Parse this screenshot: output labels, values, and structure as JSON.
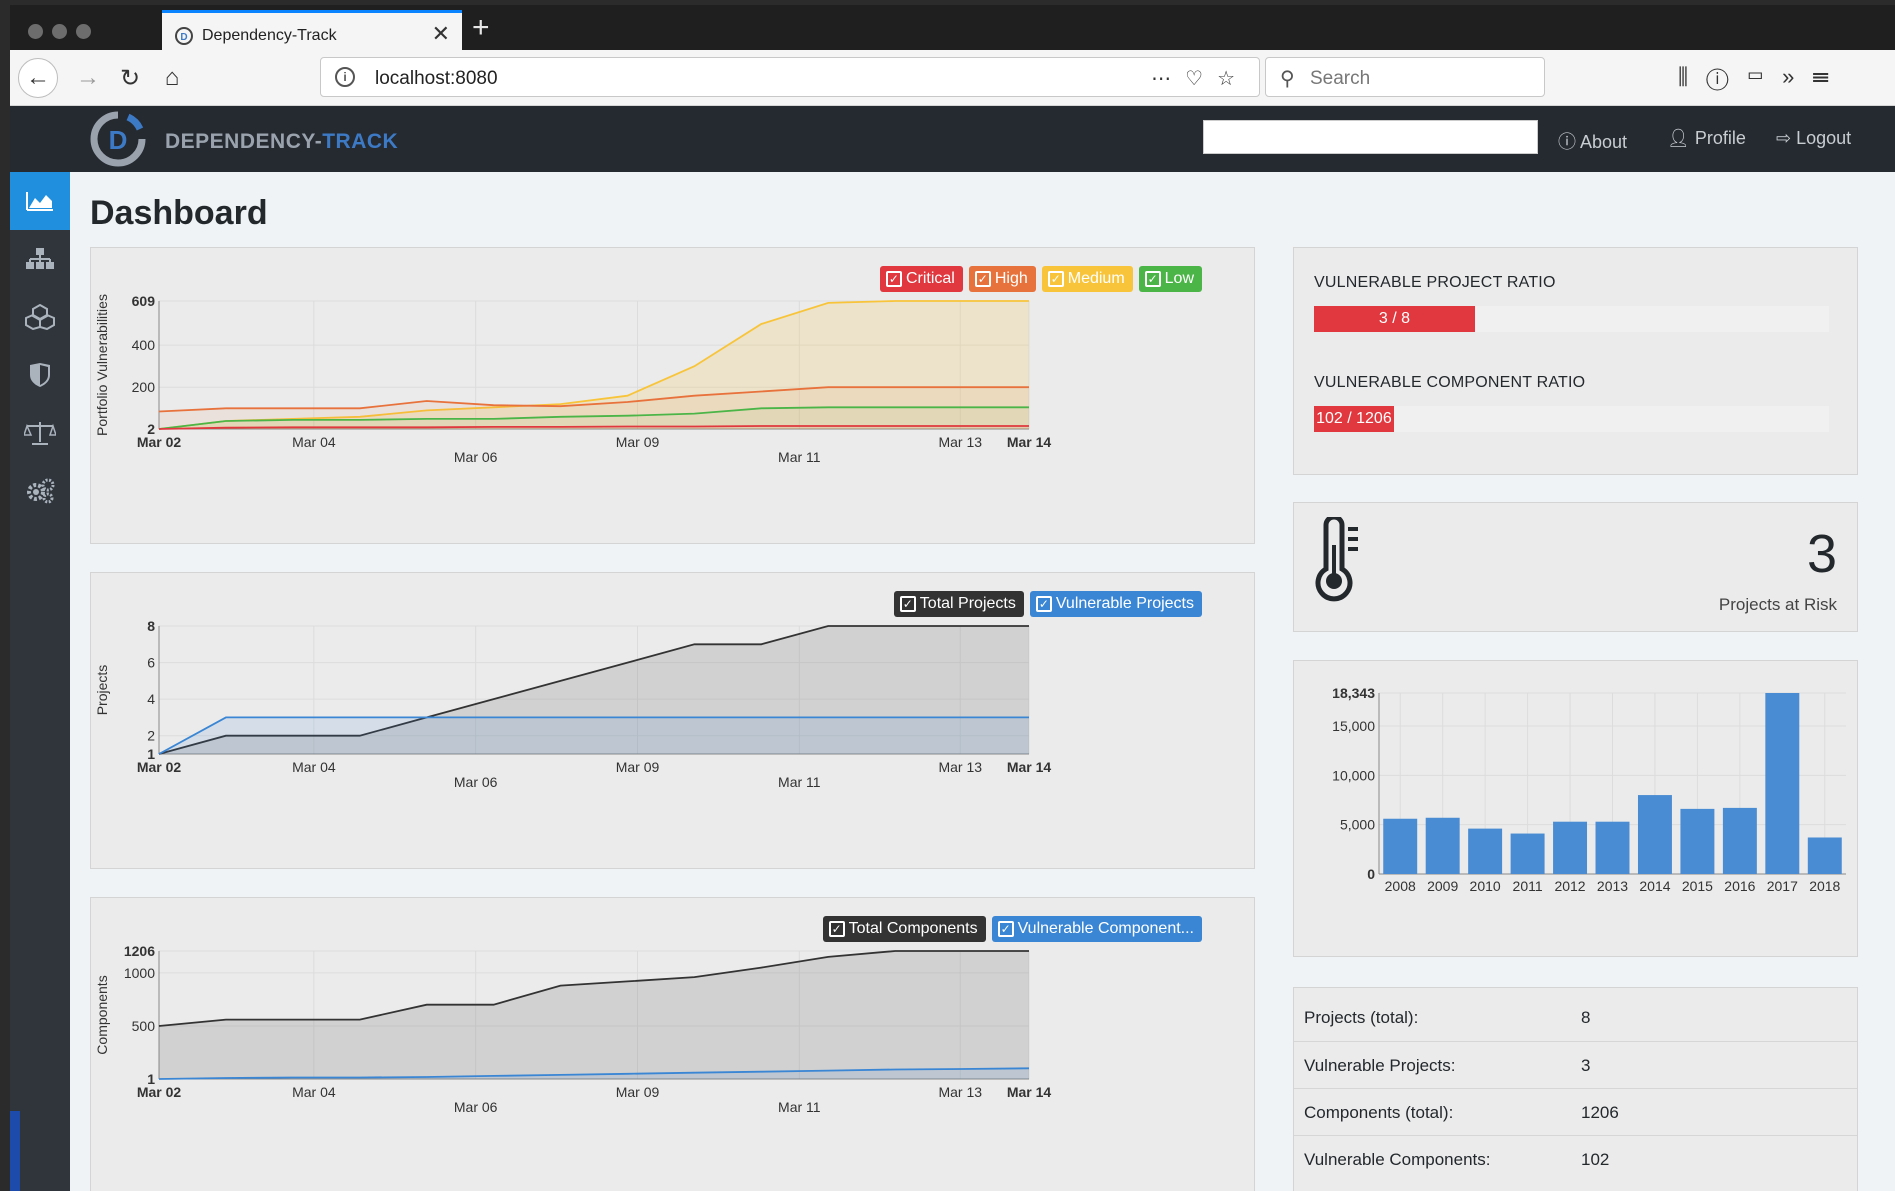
{
  "browser": {
    "tab_title": "Dependency-Track",
    "url": "localhost:8080",
    "search_placeholder": "Search"
  },
  "app": {
    "logo_text_main": "DEPENDENCY-",
    "logo_text_accent": "TRACK",
    "nav": {
      "about": "About",
      "profile": "Profile",
      "logout": "Logout"
    }
  },
  "sidebar": {
    "items": [
      {
        "icon": "dashboard-chart-icon",
        "active": true
      },
      {
        "icon": "projects-hierarchy-icon",
        "active": false
      },
      {
        "icon": "components-cubes-icon",
        "active": false
      },
      {
        "icon": "vulnerabilities-shield-icon",
        "active": false
      },
      {
        "icon": "license-scale-icon",
        "active": false
      },
      {
        "icon": "admin-gears-icon",
        "active": false
      }
    ]
  },
  "page_title": "Dashboard",
  "colors": {
    "critical": "#e0383e",
    "high": "#e8723c",
    "medium": "#f8c43a",
    "low": "#4cb548",
    "total": "#333333",
    "vulnerable": "#3a86d4",
    "bar": "#4a8cd3"
  },
  "chart_data": [
    {
      "type": "area",
      "ylabel": "Portfolio Vulnerabilities",
      "ylim": [
        2,
        609
      ],
      "yticks": [
        "2",
        "200",
        "400",
        "609"
      ],
      "x_labels": [
        "Mar 02",
        "Mar 04",
        "Mar 06",
        "Mar 09",
        "Mar 11",
        "Mar 13",
        "Mar 14"
      ],
      "legend": [
        "Critical",
        "High",
        "Medium",
        "Low"
      ],
      "series": [
        {
          "name": "Medium",
          "values": [
            2,
            40,
            50,
            60,
            90,
            105,
            120,
            160,
            300,
            500,
            600,
            609,
            609,
            609
          ]
        },
        {
          "name": "High",
          "values": [
            85,
            100,
            100,
            100,
            135,
            115,
            110,
            130,
            160,
            180,
            200,
            200,
            200,
            200
          ]
        },
        {
          "name": "Low",
          "values": [
            2,
            40,
            45,
            45,
            50,
            50,
            60,
            65,
            75,
            100,
            105,
            105,
            105,
            105
          ]
        },
        {
          "name": "Critical",
          "values": [
            2,
            8,
            10,
            10,
            10,
            12,
            12,
            14,
            14,
            16,
            16,
            16,
            16,
            16
          ]
        }
      ]
    },
    {
      "type": "area",
      "ylabel": "Projects",
      "ylim": [
        1,
        8
      ],
      "yticks": [
        "1",
        "2",
        "4",
        "6",
        "8"
      ],
      "x_labels": [
        "Mar 02",
        "Mar 04",
        "Mar 06",
        "Mar 09",
        "Mar 11",
        "Mar 13",
        "Mar 14"
      ],
      "legend": [
        "Total Projects",
        "Vulnerable Projects"
      ],
      "series": [
        {
          "name": "Total Projects",
          "values": [
            1,
            2,
            2,
            2,
            3,
            4,
            5,
            6,
            7,
            7,
            8,
            8,
            8,
            8
          ]
        },
        {
          "name": "Vulnerable Projects",
          "values": [
            1,
            3,
            3,
            3,
            3,
            3,
            3,
            3,
            3,
            3,
            3,
            3,
            3,
            3
          ]
        }
      ]
    },
    {
      "type": "area",
      "ylabel": "Components",
      "ylim": [
        1,
        1206
      ],
      "yticks": [
        "1",
        "500",
        "1000",
        "1206"
      ],
      "x_labels": [
        "Mar 02",
        "Mar 04",
        "Mar 06",
        "Mar 09",
        "Mar 11",
        "Mar 13",
        "Mar 14"
      ],
      "legend": [
        "Total Components",
        "Vulnerable Component..."
      ],
      "series": [
        {
          "name": "Total Components",
          "values": [
            500,
            560,
            560,
            560,
            700,
            700,
            880,
            920,
            960,
            1050,
            1150,
            1206,
            1206,
            1206
          ]
        },
        {
          "name": "Vulnerable Components",
          "values": [
            1,
            10,
            15,
            15,
            20,
            30,
            40,
            50,
            60,
            70,
            80,
            90,
            95,
            102
          ]
        }
      ]
    },
    {
      "type": "bar",
      "categories": [
        "2008",
        "2009",
        "2010",
        "2011",
        "2012",
        "2013",
        "2014",
        "2015",
        "2016",
        "2017",
        "2018"
      ],
      "values": [
        5600,
        5700,
        4600,
        4100,
        5300,
        5300,
        8000,
        6600,
        6700,
        18343,
        3700
      ],
      "yticks": [
        "0",
        "5,000",
        "10,000",
        "15,000",
        "18,343"
      ],
      "ylim": [
        0,
        18343
      ]
    }
  ],
  "ratios": {
    "project": {
      "title": "VULNERABLE PROJECT RATIO",
      "label": "3 / 8",
      "fraction": 0.3125
    },
    "component": {
      "title": "VULNERABLE COMPONENT RATIO",
      "label": "102 / 1206",
      "fraction": 0.155
    }
  },
  "risk": {
    "value": "3",
    "label": "Projects at Risk"
  },
  "stats": [
    {
      "label": "Projects (total):",
      "value": "8"
    },
    {
      "label": "Vulnerable Projects:",
      "value": "3"
    },
    {
      "label": "Components (total):",
      "value": "1206"
    },
    {
      "label": "Vulnerable Components:",
      "value": "102"
    }
  ]
}
